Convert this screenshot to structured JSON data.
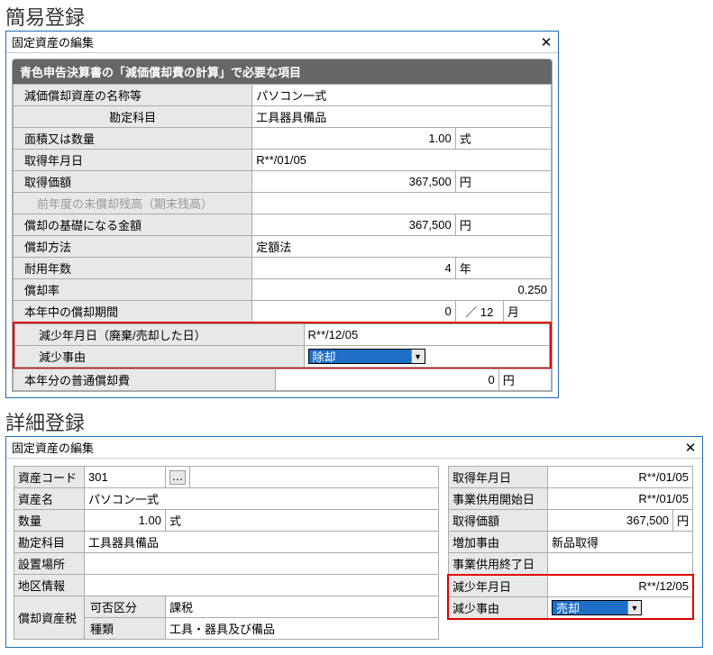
{
  "simple": {
    "heading": "簡易登録",
    "window_title": "固定資産の編集",
    "panel_title": "青色申告決算書の「減価償却費の計算」で必要な項目",
    "rows": {
      "name_label": "減価償却資産の名称等",
      "name_value": "パソコン一式",
      "account_label": "勘定科目",
      "account_value": "工具器具備品",
      "area_label": "面積又は数量",
      "area_value": "1.00",
      "area_unit": "式",
      "acq_date_label": "取得年月日",
      "acq_date_value": "R**/01/05",
      "acq_price_label": "取得価額",
      "acq_price_value": "367,500",
      "acq_price_unit": "円",
      "prev_balance_label": "前年度の未償却残高（期末残高）",
      "basis_label": "償却の基礎になる金額",
      "basis_value": "367,500",
      "basis_unit": "円",
      "method_label": "償却方法",
      "method_value": "定額法",
      "years_label": "耐用年数",
      "years_value": "4",
      "years_unit": "年",
      "rate_label": "償却率",
      "rate_value": "0.250",
      "period_label": "本年中の償却期間",
      "period_value": "0",
      "period_sep": "／",
      "period_total": "12",
      "period_unit": "月",
      "decrease_date_label": "減少年月日（廃棄/売却した日）",
      "decrease_date_value": "R**/12/05",
      "decrease_reason_label": "減少事由",
      "decrease_reason_value": "除却",
      "ordinary_label": "本年分の普通償却費",
      "ordinary_value": "0",
      "ordinary_unit": "円"
    }
  },
  "detail": {
    "heading": "詳細登録",
    "window_title": "固定資産の編集",
    "left": {
      "code_label": "資産コード",
      "code_value": "301",
      "name_label": "資産名",
      "name_value": "パソコン一式",
      "qty_label": "数量",
      "qty_value": "1.00",
      "qty_unit": "式",
      "account_label": "勘定科目",
      "account_value": "工具器具備品",
      "location_label": "設置場所",
      "region_label": "地区情報",
      "tax_label": "償却資産税",
      "tax_allow_label": "可否区分",
      "tax_allow_value": "課税",
      "type_label": "種類",
      "type_value": "工具・器具及び備品"
    },
    "right": {
      "acq_date_label": "取得年月日",
      "acq_date_value": "R**/01/05",
      "start_date_label": "事業供用開始日",
      "start_date_value": "R**/01/05",
      "acq_price_label": "取得価額",
      "acq_price_value": "367,500",
      "acq_price_unit": "円",
      "increase_label": "増加事由",
      "increase_value": "新品取得",
      "end_date_label": "事業供用終了日",
      "decrease_date_label": "減少年月日",
      "decrease_date_value": "R**/12/05",
      "decrease_reason_label": "減少事由",
      "decrease_reason_value": "売却"
    }
  }
}
